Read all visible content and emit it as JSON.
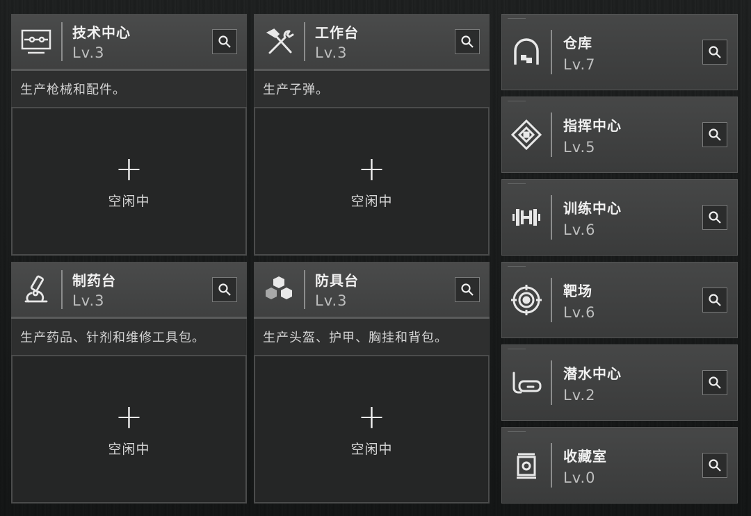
{
  "stations": [
    {
      "id": "tech",
      "name": "技术中心",
      "level": "Lv.3",
      "icon": "computer-icon",
      "description": "生产枪械和配件。",
      "slot_label": "空闲中",
      "plus": "+"
    },
    {
      "id": "workbench",
      "name": "工作台",
      "level": "Lv.3",
      "icon": "hammer-wrench-icon",
      "description": "生产子弹。",
      "slot_label": "空闲中",
      "plus": "+"
    },
    {
      "id": "pharma",
      "name": "制药台",
      "level": "Lv.3",
      "icon": "microscope-icon",
      "description": "生产药品、针剂和维修工具包。",
      "slot_label": "空闲中",
      "plus": "+"
    },
    {
      "id": "armor",
      "name": "防具台",
      "level": "Lv.3",
      "icon": "cubes-icon",
      "description": "生产头盔、护甲、胸挂和背包。",
      "slot_label": "空闲中",
      "plus": "+"
    }
  ],
  "facilities": [
    {
      "id": "warehouse",
      "name": "仓库",
      "level": "Lv.7",
      "icon": "warehouse-icon"
    },
    {
      "id": "command",
      "name": "指挥中心",
      "level": "Lv.5",
      "icon": "emblem-icon"
    },
    {
      "id": "training",
      "name": "训练中心",
      "level": "Lv.6",
      "icon": "dumbbell-icon"
    },
    {
      "id": "range",
      "name": "靶场",
      "level": "Lv.6",
      "icon": "target-icon"
    },
    {
      "id": "diving",
      "name": "潜水中心",
      "level": "Lv.2",
      "icon": "diving-mask-icon"
    },
    {
      "id": "collection",
      "name": "收藏室",
      "level": "Lv.0",
      "icon": "display-case-icon"
    }
  ],
  "icons": {
    "search": "search-icon"
  },
  "colors": {
    "card_header": "#464747",
    "card_body": "#252626",
    "text": "#f1f1f1",
    "level_text": "#bdbebe"
  }
}
